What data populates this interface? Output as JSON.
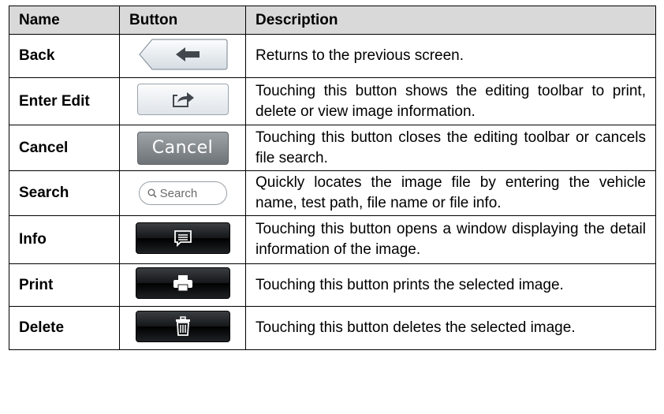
{
  "table": {
    "headers": [
      "Name",
      "Button",
      "Description"
    ],
    "rows": [
      {
        "name": "Back",
        "button": {
          "type": "back-arrow-icon"
        },
        "description": "Returns to the previous screen."
      },
      {
        "name": "Enter Edit",
        "button": {
          "type": "share-export-icon"
        },
        "description": "Touching this button shows the editing toolbar to print, delete or view image information."
      },
      {
        "name": "Cancel",
        "button": {
          "type": "text",
          "label": "Cancel"
        },
        "description": "Touching this button closes the editing toolbar or cancels file search."
      },
      {
        "name": "Search",
        "button": {
          "type": "search-field",
          "label": "Search"
        },
        "description": "Quickly locates the image file by entering the vehicle name, test path, file name or file info."
      },
      {
        "name": "Info",
        "button": {
          "type": "info-message-icon"
        },
        "description": "Touching this button opens a window displaying the detail information of the image."
      },
      {
        "name": "Print",
        "button": {
          "type": "printer-icon"
        },
        "description": "Touching this button prints the selected image."
      },
      {
        "name": "Delete",
        "button": {
          "type": "trash-icon"
        },
        "description": "Touching this button deletes the selected image."
      }
    ]
  }
}
